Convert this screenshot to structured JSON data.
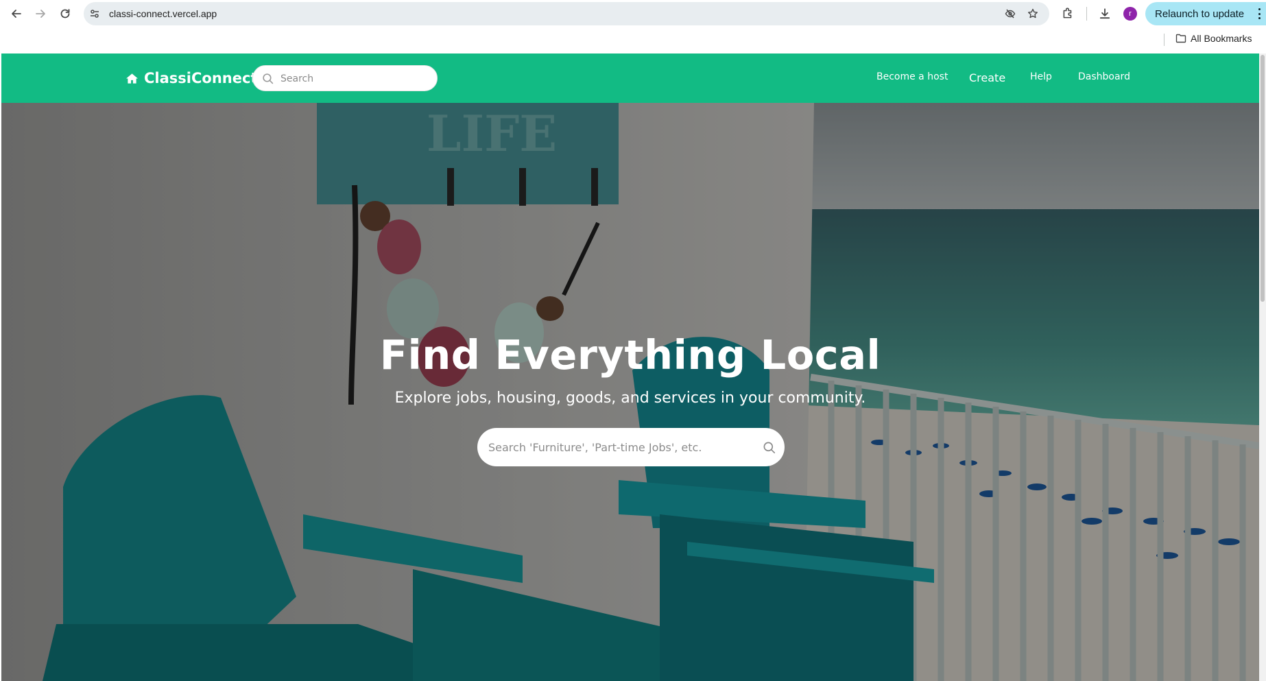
{
  "browser": {
    "url": "classi-connect.vercel.app",
    "relaunch_label": "Relaunch to update",
    "avatar_letter": "r",
    "bookmarks_label": "All Bookmarks"
  },
  "header": {
    "brand": "ClassiConnect",
    "search_placeholder": "Search",
    "nav": {
      "become_host": "Become a host",
      "create": "Create",
      "help": "Help",
      "dashboard": "Dashboard"
    },
    "color": "#12bb84"
  },
  "hero": {
    "title": "Find Everything Local",
    "subtitle": "Explore jobs, housing, goods, and services in your community.",
    "search_placeholder": "Search 'Furniture', 'Part-time Jobs', etc.",
    "background_description_icon": "beach-balcony-image"
  }
}
